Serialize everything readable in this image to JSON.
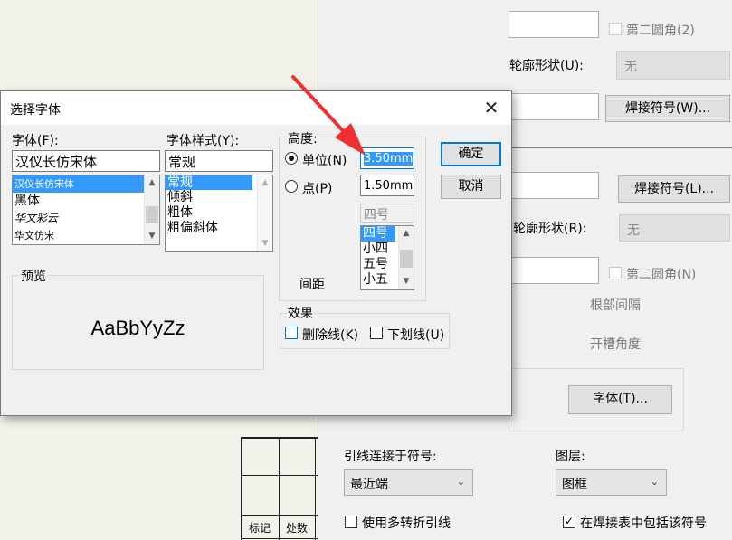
{
  "dialog": {
    "title": "选择字体",
    "font_label": "字体(F):",
    "font_value": "汉仪长仿宋体",
    "font_items": [
      "汉仪长仿宋体",
      "黑体",
      "华文彩云",
      "华文仿宋"
    ],
    "style_label": "字体样式(Y):",
    "style_value": "常规",
    "style_items": [
      "常规",
      "倾斜",
      "粗体",
      "粗偏斜体"
    ],
    "height_label": "高度:",
    "unit_label": "单位(N)",
    "unit_value": "3.50mm",
    "point_label": "点(P)",
    "point_value": "1.50mm",
    "size_value": "四号",
    "size_items": [
      "四号",
      "小四",
      "五号",
      "小五"
    ],
    "spacing_label": "间距",
    "preview_label": "预览",
    "preview_text": "AaBbYyZz",
    "effects_label": "效果",
    "strikethrough_label": "删除线(K)",
    "underline_label": "下划线(U)",
    "ok_label": "确定",
    "cancel_label": "取消"
  },
  "panel": {
    "second_fillet_2": "第二圆角(2)",
    "contour_shape_u": "轮廓形状(U):",
    "contour_value_u": "无",
    "weld_symbol_w": "焊接符号(W)...",
    "weld_symbol_l": "焊接符号(L)...",
    "contour_shape_r": "轮廓形状(R):",
    "contour_value_r": "无",
    "second_fillet_n": "第二圆角(N)",
    "root_gap": "根部间隔",
    "groove_angle": "开槽角度",
    "font_button": "字体(T)...",
    "leader_label": "引线连接于符号:",
    "leader_value": "最近端",
    "layer_label": "图层:",
    "layer_value": "图框",
    "multi_bend_label": "使用多转折引线",
    "include_in_table_label": "在焊接表中包括该符号"
  },
  "title_block": {
    "cell_mark": "标记",
    "cell_count": "处数"
  },
  "colors": {
    "selection": "#3399ff",
    "arrow": "#f03030",
    "focus": "#0078d7"
  }
}
